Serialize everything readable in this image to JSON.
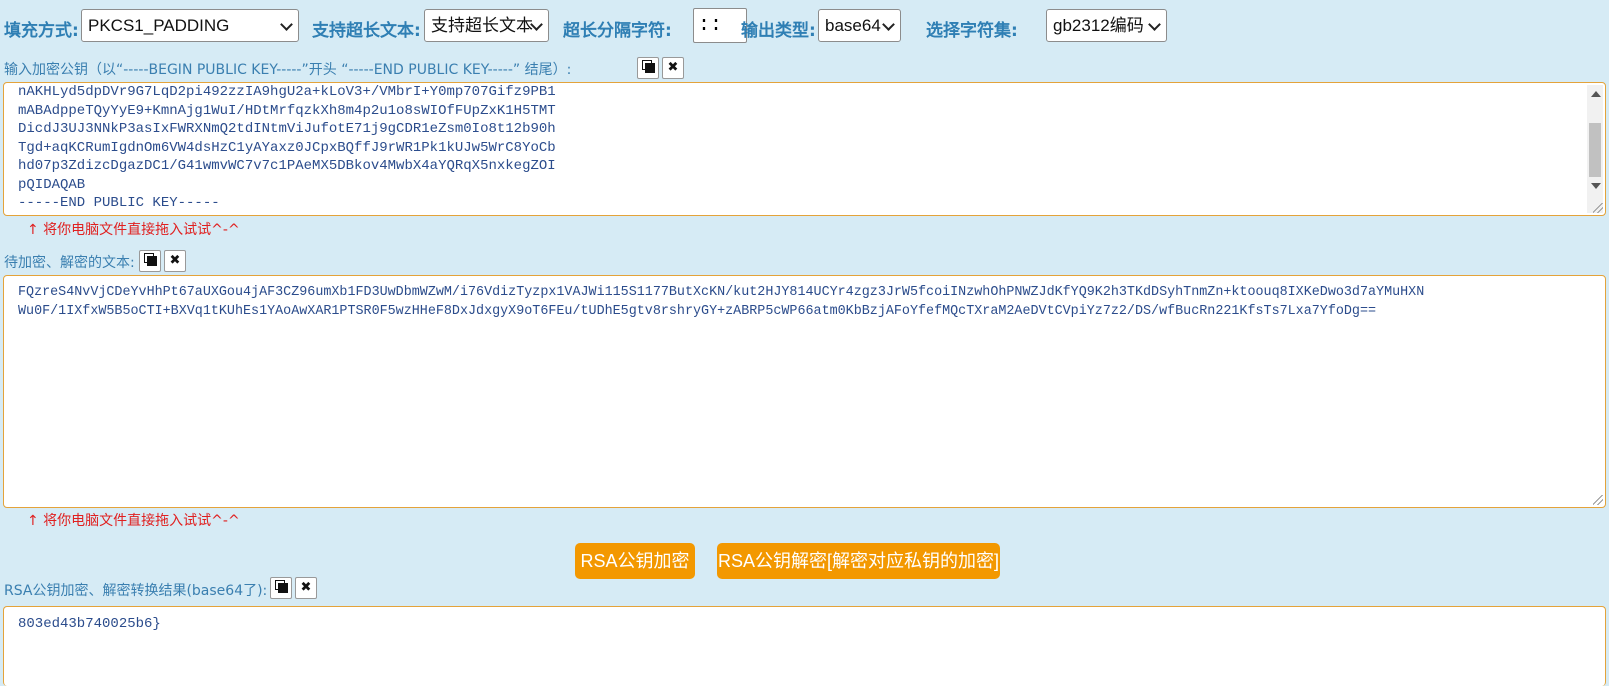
{
  "toolbar": {
    "padding_label": "填充方式:",
    "padding_value": "PKCS1_PADDING",
    "longtext_label": "支持超长文本:",
    "longtext_value": "支持超长文本",
    "separator_label": "超长分隔字符:",
    "separator_value": "::",
    "output_label": "输出类型:",
    "output_value": "base64",
    "charset_label": "选择字符集:",
    "charset_value": "gb2312编码"
  },
  "pubkey": {
    "label": "输入加密公钥（以“-----BEGIN PUBLIC KEY-----”开头 “-----END PUBLIC KEY-----” 结尾）:",
    "lines": [
      "nAKHLyd5dpDVr9G7LqD2pi492zzIA9hgU2a+kLoV3+/VMbrI+Y0mp707Gifz9PB1",
      "mABAdppeTQyYyE9+KmnAjg1WuI/HDtMrfqzkXh8m4p2u1o8sWIOfFUpZxK1H5TMT",
      "DicdJ3UJ3NNkP3asIxFWRXNmQ2tdINtmViJufotE71j9gCDR1eZsm0Io8t12b90h",
      "Tgd+aqKCRumIgdnOm6VW4dsHzC1yAYaxz0JCpxBQffJ9rWR1Pk1kUJw5WrC8YoCb",
      "hd07p3ZdizcDgazDC1/G41wmvWC7v7c1PAeMX5DBkov4MwbX4aYQRqX5nxkegZOI",
      "pQIDAQAB",
      "-----END PUBLIC KEY-----"
    ],
    "drag_hint": "↑ 将你电脑文件直接拖入试试^-^"
  },
  "plaintext": {
    "label": "待加密、解密的文本:",
    "lines": [
      "FQzreS4NvVjCDeYvHhPt67aUXGou4jAF3CZ96umXb1FD3UwDbmWZwM/i76VdizTyzpx1VAJWi115S1177ButXcKN/kut2HJY814UCYr4zgz3JrW5fcoiINzwhOhPNWZJdKfYQ9K2h3TKdDSyhTnmZn+ktoouq8IXKeDwo3d7aYMuHXN",
      "Wu0F/1IXfxW5B5oCTI+BXVq1tKUhEs1YAoAwXAR1PTSR0F5wzHHeF8DxJdxgyX9oT6FEu/tUDhE5gtv8rshryGY+zABRP5cWP66atm0KbBzjAFoYfefMQcTXraM2AeDVtCVpiYz7z2/DS/wfBucRn221KfsTs7Lxa7YfoDg=="
    ],
    "drag_hint": "↑ 将你电脑文件直接拖入试试^-^"
  },
  "actions": {
    "encrypt_label": "RSA公钥加密",
    "decrypt_label": "RSA公钥解密[解密对应私钥的加密]"
  },
  "result": {
    "label": "RSA公钥加密、解密转换结果(base64了):",
    "text": "803ed43b740025b6}"
  },
  "colors": {
    "background": "#d6ebf5",
    "label_blue": "#2f7fb4",
    "accent_orange": "#f39800",
    "hint_red": "#e02020",
    "border_orange": "#e4a33a"
  },
  "icons": [
    "chevron-down-icon",
    "copy-icon",
    "close-icon",
    "scroll-up-icon",
    "scroll-down-icon",
    "resize-grip-icon"
  ]
}
